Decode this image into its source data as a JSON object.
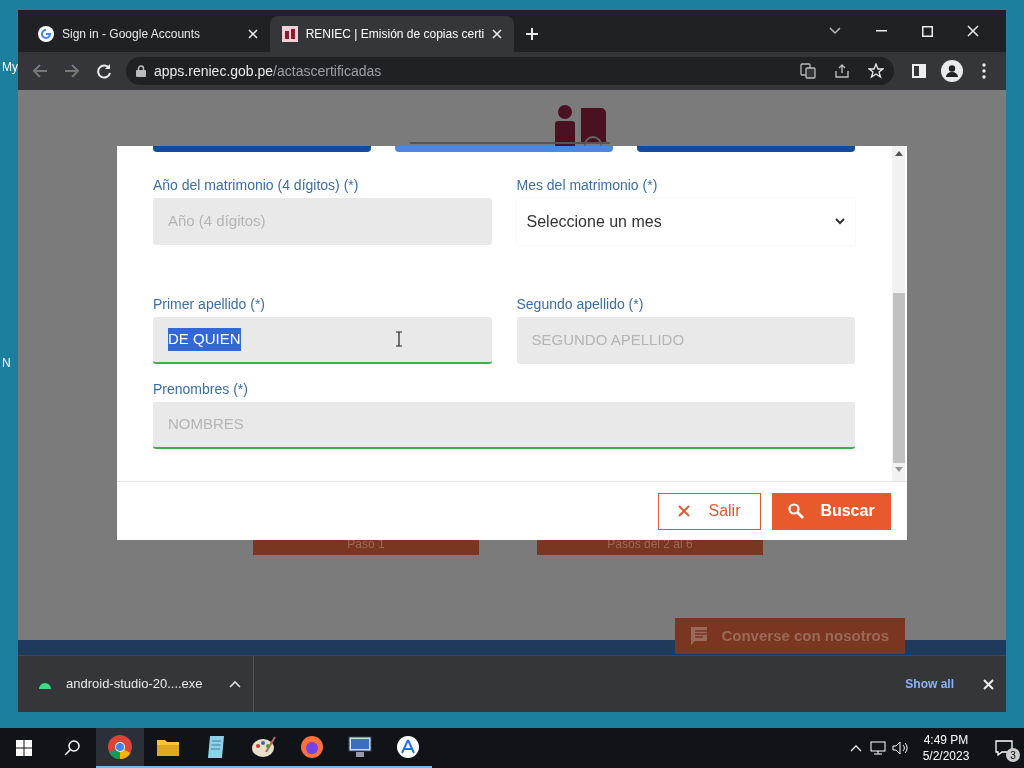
{
  "desktop": {
    "icon_labels": [
      "My",
      "N"
    ]
  },
  "browser": {
    "tabs": [
      {
        "title": "Sign in - Google Accounts",
        "selected": false
      },
      {
        "title": "RENIEC | Emisión de copias certi",
        "selected": true
      }
    ],
    "address": {
      "domain": "apps.reniec.gob.pe",
      "path": "/actascertificadas"
    }
  },
  "page": {
    "step_buttons": [
      "Paso 1",
      "Pasos del 2 al 6"
    ],
    "chat_button": "Converse con nosotros"
  },
  "modal": {
    "step_tabs": [
      {
        "selected": false
      },
      {
        "selected": true
      },
      {
        "selected": false
      }
    ],
    "fields": [
      {
        "label": "Año del matrimonio (4 dígitos) (*)",
        "kind": "input",
        "placeholder": "Año (4 dígitos)"
      },
      {
        "label": "Mes del matrimonio (*)",
        "kind": "select",
        "value": "Seleccione un mes"
      },
      {
        "label": "Primer apellido (*)",
        "kind": "input",
        "value": "DE QUIEN",
        "text_selected": true,
        "valid": true
      },
      {
        "label": "Segundo apellido (*)",
        "kind": "input",
        "placeholder": "SEGUNDO APELLIDO"
      },
      {
        "label": "Prenombres (*)",
        "kind": "input",
        "placeholder": "NOMBRES",
        "valid": true,
        "wide": true
      }
    ],
    "buttons": [
      {
        "label": "Salir",
        "kind": "outline"
      },
      {
        "label": "Buscar",
        "kind": "primary"
      }
    ]
  },
  "downloads": {
    "file": "android-studio-20....exe",
    "show_all": "Show all"
  },
  "taskbar": {
    "time": "4:49 PM",
    "date": "5/2/2023",
    "notifications": "3"
  }
}
